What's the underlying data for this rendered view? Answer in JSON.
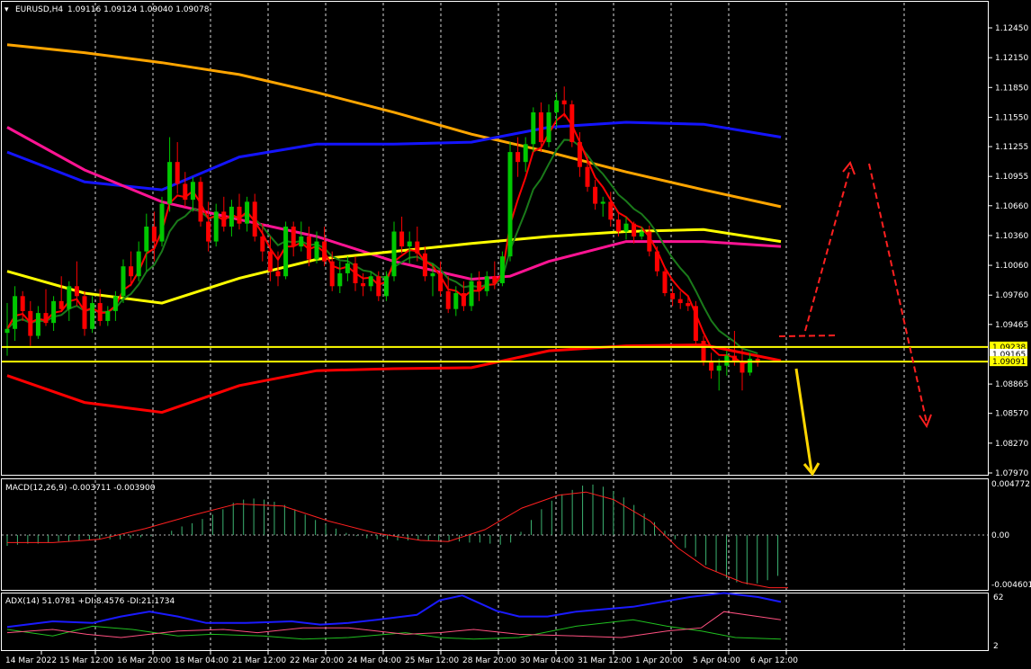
{
  "chart_data": {
    "type": "line",
    "symbol": "EURUSD,H4",
    "ohlc_header": "1.09116 1.09124 1.09040 1.09078",
    "x_labels": [
      "14 Mar 2022",
      "15 Mar 12:00",
      "16 Mar 20:00",
      "18 Mar 04:00",
      "21 Mar 12:00",
      "22 Mar 20:00",
      "24 Mar 04:00",
      "25 Mar 12:00",
      "28 Mar 20:00",
      "30 Mar 04:00",
      "31 Mar 12:00",
      "1 Apr 20:00",
      "5 Apr 04:00",
      "6 Apr 12:00"
    ],
    "price_axis": {
      "ticks": [
        "1.12450",
        "1.12150",
        "1.11850",
        "1.11550",
        "1.11255",
        "1.10955",
        "1.10660",
        "1.10360",
        "1.10060",
        "1.09760",
        "1.09465",
        "1.08865",
        "1.08570",
        "1.08270",
        "1.07970"
      ],
      "ylim": [
        1.0797,
        1.1245
      ],
      "level_tags": [
        {
          "text": "1.09238",
          "value": 1.09238,
          "color": "#ffff00"
        },
        {
          "text": "1.09165",
          "value": 1.09165,
          "color": "#ffffff"
        },
        {
          "text": "1.09091",
          "value": 1.09091,
          "color": "#ffff00"
        }
      ]
    },
    "candles": [
      [
        1.0938,
        1.0968,
        1.0915,
        1.0942
      ],
      [
        1.0942,
        1.0985,
        1.093,
        1.0975
      ],
      [
        1.0975,
        1.098,
        1.095,
        1.096
      ],
      [
        1.096,
        1.097,
        1.0925,
        1.0935
      ],
      [
        1.0935,
        1.0965,
        1.0932,
        1.0958
      ],
      [
        1.0958,
        1.0982,
        1.0945,
        1.0948
      ],
      [
        1.0948,
        1.0975,
        1.094,
        1.097
      ],
      [
        1.097,
        1.0995,
        1.096,
        1.0962
      ],
      [
        1.0962,
        1.099,
        1.095,
        1.0985
      ],
      [
        1.0985,
        1.101,
        1.0965,
        1.0975
      ],
      [
        1.0975,
        1.098,
        1.0935,
        1.0942
      ],
      [
        1.0942,
        1.0975,
        1.0938,
        1.0968
      ],
      [
        1.0968,
        1.0982,
        1.0945,
        1.095
      ],
      [
        1.095,
        1.0965,
        1.0945,
        1.096
      ],
      [
        1.096,
        1.098,
        1.095,
        1.0975
      ],
      [
        1.0975,
        1.1012,
        1.0968,
        1.1005
      ],
      [
        1.1005,
        1.102,
        1.0985,
        1.0995
      ],
      [
        1.0995,
        1.103,
        1.099,
        1.102
      ],
      [
        1.102,
        1.1058,
        1.1,
        1.1045
      ],
      [
        1.1045,
        1.106,
        1.101,
        1.103
      ],
      [
        1.103,
        1.1075,
        1.1025,
        1.1068
      ],
      [
        1.1068,
        1.1135,
        1.106,
        1.111
      ],
      [
        1.111,
        1.113,
        1.1078,
        1.1088
      ],
      [
        1.1088,
        1.11,
        1.1065,
        1.1072
      ],
      [
        1.1072,
        1.1095,
        1.106,
        1.109
      ],
      [
        1.109,
        1.1095,
        1.1045,
        1.105
      ],
      [
        1.105,
        1.107,
        1.102,
        1.103
      ],
      [
        1.103,
        1.1068,
        1.1025,
        1.106
      ],
      [
        1.106,
        1.1075,
        1.104,
        1.1045
      ],
      [
        1.1045,
        1.1072,
        1.1035,
        1.1065
      ],
      [
        1.1065,
        1.1078,
        1.1042,
        1.1048
      ],
      [
        1.1048,
        1.1075,
        1.104,
        1.107
      ],
      [
        1.107,
        1.1078,
        1.103,
        1.1035
      ],
      [
        1.1035,
        1.1048,
        1.101,
        1.102
      ],
      [
        1.102,
        1.1035,
        1.099,
        1.1
      ],
      [
        1.1,
        1.102,
        1.0985,
        1.0995
      ],
      [
        1.0995,
        1.105,
        1.0992,
        1.1045
      ],
      [
        1.1045,
        1.105,
        1.1015,
        1.1025
      ],
      [
        1.1025,
        1.105,
        1.102,
        1.1035
      ],
      [
        1.1035,
        1.1045,
        1.1005,
        1.1012
      ],
      [
        1.1012,
        1.104,
        1.1008,
        1.103
      ],
      [
        1.103,
        1.1045,
        1.1005,
        1.101
      ],
      [
        1.101,
        1.102,
        1.098,
        1.0985
      ],
      [
        1.0985,
        1.101,
        1.0978,
        1.0998
      ],
      [
        1.0998,
        1.1015,
        1.099,
        1.1008
      ],
      [
        1.1008,
        1.1015,
        1.098,
        1.0988
      ],
      [
        1.0988,
        1.0998,
        1.0975,
        1.0985
      ],
      [
        1.0985,
        1.1,
        1.098,
        1.0995
      ],
      [
        1.0995,
        1.1,
        1.097,
        1.0975
      ],
      [
        1.0975,
        1.1,
        1.097,
        1.0995
      ],
      [
        1.0995,
        1.105,
        1.099,
        1.104
      ],
      [
        1.104,
        1.1055,
        1.1018,
        1.1025
      ],
      [
        1.1025,
        1.104,
        1.1008,
        1.103
      ],
      [
        1.103,
        1.1045,
        1.101,
        1.1018
      ],
      [
        1.1018,
        1.1025,
        1.099,
        1.0995
      ],
      [
        1.0995,
        1.1008,
        1.0975,
        1.0998
      ],
      [
        1.0998,
        1.101,
        1.0975,
        1.098
      ],
      [
        1.098,
        1.0995,
        1.0958,
        1.0962
      ],
      [
        1.0962,
        1.0985,
        1.0955,
        1.0978
      ],
      [
        1.0978,
        1.099,
        1.096,
        1.0965
      ],
      [
        1.0965,
        1.0998,
        1.096,
        1.099
      ],
      [
        1.099,
        1.1,
        1.097,
        1.098
      ],
      [
        1.098,
        1.1,
        1.0975,
        1.0995
      ],
      [
        1.0995,
        1.101,
        1.0982,
        1.0988
      ],
      [
        1.0988,
        1.102,
        1.0985,
        1.1015
      ],
      [
        1.1015,
        1.113,
        1.101,
        1.112
      ],
      [
        1.112,
        1.1135,
        1.1095,
        1.111
      ],
      [
        1.111,
        1.1135,
        1.11,
        1.1128
      ],
      [
        1.1128,
        1.1165,
        1.112,
        1.116
      ],
      [
        1.116,
        1.117,
        1.112,
        1.113
      ],
      [
        1.113,
        1.1168,
        1.1125,
        1.116
      ],
      [
        1.116,
        1.118,
        1.1145,
        1.1172
      ],
      [
        1.1172,
        1.1186,
        1.1155,
        1.1168
      ],
      [
        1.1168,
        1.1172,
        1.1125,
        1.113
      ],
      [
        1.113,
        1.114,
        1.1095,
        1.1105
      ],
      [
        1.1105,
        1.1115,
        1.108,
        1.1085
      ],
      [
        1.1085,
        1.1092,
        1.1062,
        1.1068
      ],
      [
        1.1068,
        1.1075,
        1.1055,
        1.107
      ],
      [
        1.107,
        1.108,
        1.1045,
        1.1052
      ],
      [
        1.1052,
        1.106,
        1.1035,
        1.104
      ],
      [
        1.104,
        1.1055,
        1.1032,
        1.1048
      ],
      [
        1.1048,
        1.105,
        1.1028,
        1.1035
      ],
      [
        1.1035,
        1.1045,
        1.1032,
        1.104
      ],
      [
        1.104,
        1.1046,
        1.1015,
        1.102
      ],
      [
        1.102,
        1.1025,
        1.0995,
        1.1
      ],
      [
        1.1,
        1.1005,
        1.0975,
        1.0978
      ],
      [
        1.0978,
        1.0985,
        1.0965,
        1.0972
      ],
      [
        1.0972,
        1.098,
        1.0962,
        1.0968
      ],
      [
        1.0968,
        1.0975,
        1.096,
        1.0965
      ],
      [
        1.0965,
        1.097,
        1.0925,
        1.093
      ],
      [
        1.093,
        1.0935,
        1.0905,
        1.091
      ],
      [
        1.091,
        1.0918,
        1.0892,
        1.09
      ],
      [
        1.09,
        1.0912,
        1.088,
        1.0905
      ],
      [
        1.0905,
        1.092,
        1.0895,
        1.0915
      ],
      [
        1.0915,
        1.094,
        1.0905,
        1.091
      ],
      [
        1.091,
        1.0922,
        1.088,
        1.0898
      ],
      [
        1.0898,
        1.0918,
        1.0895,
        1.0912
      ],
      [
        1.0912,
        1.0915,
        1.0904,
        1.0908
      ]
    ],
    "moving_averages": [
      {
        "color": "#ffa500",
        "points": [
          [
            0,
            1.1228
          ],
          [
            10,
            1.122
          ],
          [
            20,
            1.121
          ],
          [
            30,
            1.1198
          ],
          [
            40,
            1.118
          ],
          [
            50,
            1.116
          ],
          [
            60,
            1.1138
          ],
          [
            70,
            1.112
          ],
          [
            80,
            1.11
          ],
          [
            90,
            1.1082
          ],
          [
            100,
            1.1065
          ]
        ]
      },
      {
        "color": "#1414ff",
        "points": [
          [
            0,
            1.112
          ],
          [
            10,
            1.109
          ],
          [
            20,
            1.1082
          ],
          [
            30,
            1.1115
          ],
          [
            40,
            1.1128
          ],
          [
            50,
            1.1128
          ],
          [
            60,
            1.113
          ],
          [
            70,
            1.1145
          ],
          [
            80,
            1.115
          ],
          [
            90,
            1.1148
          ],
          [
            100,
            1.1135
          ]
        ]
      },
      {
        "color": "#ff1493",
        "points": [
          [
            0,
            1.1145
          ],
          [
            10,
            1.1102
          ],
          [
            20,
            1.107
          ],
          [
            30,
            1.1052
          ],
          [
            40,
            1.1035
          ],
          [
            50,
            1.101
          ],
          [
            60,
            1.0992
          ],
          [
            65,
            1.0995
          ],
          [
            70,
            1.101
          ],
          [
            80,
            1.103
          ],
          [
            90,
            1.103
          ],
          [
            100,
            1.1025
          ]
        ]
      },
      {
        "color": "#ffff00",
        "points": [
          [
            0,
            1.1
          ],
          [
            10,
            1.0978
          ],
          [
            20,
            1.0968
          ],
          [
            30,
            1.0993
          ],
          [
            40,
            1.1012
          ],
          [
            50,
            1.102
          ],
          [
            60,
            1.1028
          ],
          [
            70,
            1.1035
          ],
          [
            80,
            1.104
          ],
          [
            90,
            1.1042
          ],
          [
            100,
            1.103
          ]
        ]
      },
      {
        "color": "#ff0000",
        "points": [
          [
            0,
            1.0895
          ],
          [
            10,
            1.0868
          ],
          [
            20,
            1.0858
          ],
          [
            30,
            1.0885
          ],
          [
            40,
            1.09
          ],
          [
            50,
            1.0902
          ],
          [
            60,
            1.0903
          ],
          [
            70,
            1.092
          ],
          [
            80,
            1.0925
          ],
          [
            90,
            1.0926
          ],
          [
            100,
            1.091
          ]
        ]
      }
    ],
    "trendlines": [
      {
        "color": "#ffff00",
        "value": 1.09238
      },
      {
        "color": "#ffff00",
        "value": 1.09091
      }
    ],
    "macd": {
      "label": "MACD(12,26,9) -0.003711 -0.003900",
      "ylim": [
        -0.004601,
        0.004772
      ],
      "ticks": [
        "0.004772",
        "0.00",
        "-0.004601"
      ],
      "histogram": [
        -0.001,
        -0.0009,
        -0.0008,
        -0.0008,
        -0.0007,
        -0.0006,
        -0.0006,
        -0.0005,
        -0.0005,
        -0.0004,
        -0.0004,
        -0.0004,
        -0.0003,
        -0.0002,
        -0.0001,
        0.0,
        0.0004,
        0.0008,
        0.0011,
        0.0015,
        0.0019,
        0.0024,
        0.003,
        0.0033,
        0.0034,
        0.0033,
        0.0031,
        0.0028,
        0.0024,
        0.0019,
        0.0014,
        0.001,
        0.0006,
        0.0002,
        -0.0001,
        -0.0003,
        -0.0004,
        -0.0004,
        -0.0005,
        -0.0005,
        -0.0005,
        -0.0005,
        -0.0006,
        -0.0006,
        -0.0006,
        -0.0007,
        -0.0007,
        -0.0008,
        -0.0009,
        -0.0007,
        0.0003,
        0.0014,
        0.0024,
        0.0032,
        0.0038,
        0.0042,
        0.0046,
        0.0047,
        0.0045,
        0.0041,
        0.0035,
        0.0028,
        0.002,
        0.0012,
        0.0004,
        -0.0004,
        -0.0012,
        -0.002,
        -0.0028,
        -0.0034,
        -0.004,
        -0.0044,
        -0.0046,
        -0.0045,
        -0.0042,
        -0.0038
      ],
      "signal": [
        [
          0,
          -0.0007
        ],
        [
          5,
          -0.0007
        ],
        [
          10,
          -0.0004
        ],
        [
          15,
          0.0006
        ],
        [
          20,
          0.0018
        ],
        [
          25,
          0.0029
        ],
        [
          30,
          0.0027
        ],
        [
          35,
          0.0013
        ],
        [
          40,
          0.0002
        ],
        [
          45,
          -0.0005
        ],
        [
          48,
          -0.0006
        ],
        [
          52,
          0.0005
        ],
        [
          56,
          0.0025
        ],
        [
          60,
          0.0037
        ],
        [
          63,
          0.004
        ],
        [
          66,
          0.0033
        ],
        [
          70,
          0.0013
        ],
        [
          73,
          -0.0012
        ],
        [
          76,
          -0.003
        ],
        [
          80,
          -0.0044
        ],
        [
          83,
          -0.0049
        ],
        [
          85,
          -0.0049
        ]
      ]
    },
    "adx": {
      "label": "ADX(14) 51.0781 +DI:8.4576 -DI:21.1734",
      "ylim": [
        2,
        62
      ],
      "ticks": [
        "62",
        "2"
      ],
      "adx_line": [
        [
          0,
          25
        ],
        [
          8,
          32
        ],
        [
          15,
          30
        ],
        [
          20,
          38
        ],
        [
          25,
          44
        ],
        [
          30,
          38
        ],
        [
          35,
          30
        ],
        [
          42,
          30
        ],
        [
          50,
          32
        ],
        [
          55,
          28
        ],
        [
          60,
          30
        ],
        [
          65,
          34
        ],
        [
          72,
          40
        ],
        [
          76,
          58
        ],
        [
          80,
          64
        ],
        [
          86,
          45
        ],
        [
          90,
          38
        ],
        [
          95,
          38
        ],
        [
          100,
          44
        ],
        [
          110,
          50
        ],
        [
          120,
          62
        ],
        [
          126,
          67
        ],
        [
          132,
          62
        ],
        [
          136,
          56
        ]
      ],
      "plus_di": [
        [
          0,
          22
        ],
        [
          8,
          14
        ],
        [
          15,
          26
        ],
        [
          22,
          22
        ],
        [
          30,
          14
        ],
        [
          36,
          16
        ],
        [
          45,
          14
        ],
        [
          52,
          10
        ],
        [
          60,
          12
        ],
        [
          70,
          18
        ],
        [
          76,
          12
        ],
        [
          82,
          10
        ],
        [
          90,
          12
        ],
        [
          100,
          26
        ],
        [
          110,
          34
        ],
        [
          116,
          26
        ],
        [
          122,
          20
        ],
        [
          128,
          12
        ],
        [
          136,
          10
        ]
      ],
      "minus_di": [
        [
          0,
          18
        ],
        [
          8,
          22
        ],
        [
          14,
          16
        ],
        [
          20,
          12
        ],
        [
          30,
          20
        ],
        [
          38,
          22
        ],
        [
          44,
          18
        ],
        [
          52,
          24
        ],
        [
          60,
          24
        ],
        [
          70,
          16
        ],
        [
          76,
          18
        ],
        [
          82,
          22
        ],
        [
          90,
          16
        ],
        [
          100,
          14
        ],
        [
          108,
          12
        ],
        [
          116,
          20
        ],
        [
          122,
          24
        ],
        [
          126,
          44
        ],
        [
          132,
          38
        ],
        [
          136,
          34
        ]
      ]
    }
  }
}
